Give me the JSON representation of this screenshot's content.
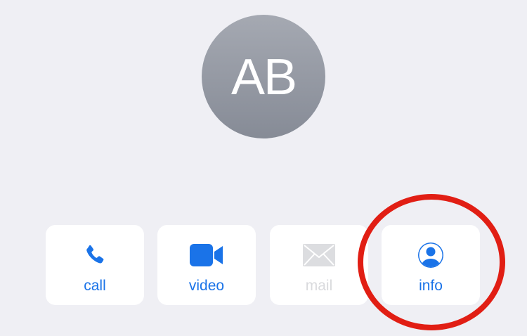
{
  "contact": {
    "initials": "AB"
  },
  "actions": [
    {
      "label": "call",
      "icon": "phone-icon",
      "enabled": true
    },
    {
      "label": "video",
      "icon": "video-camera-icon",
      "enabled": true
    },
    {
      "label": "mail",
      "icon": "envelope-icon",
      "enabled": false
    },
    {
      "label": "info",
      "icon": "person-circle-icon",
      "enabled": true
    }
  ],
  "colors": {
    "background": "#efeff4",
    "accent": "#1a73e8",
    "disabled": "#d9dadd",
    "avatar_top": "#a5a9b2",
    "avatar_bottom": "#868b96",
    "annotation": "#e11e14"
  }
}
